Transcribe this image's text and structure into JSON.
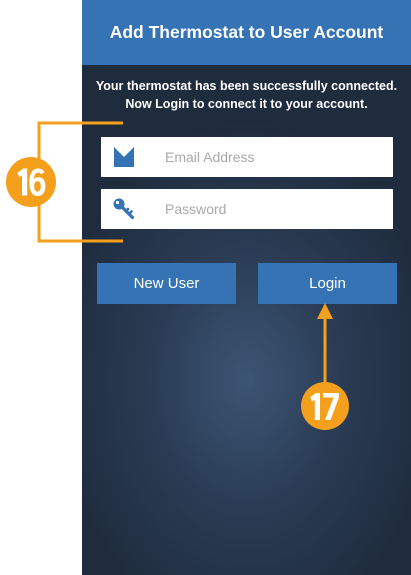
{
  "header": {
    "title": "Add Thermostat to User Account"
  },
  "message": {
    "line1": "Your thermostat has been successfully connected.",
    "line2": "Now Login to connect it to your account."
  },
  "form": {
    "email": {
      "placeholder": "Email Address",
      "value": "",
      "icon": "envelope-checkbox-icon"
    },
    "password": {
      "placeholder": "Password",
      "value": "",
      "icon": "key-icon"
    }
  },
  "buttons": {
    "new_user": "New User",
    "login": "Login"
  },
  "annotations": {
    "fields_callout": "16",
    "login_callout": "17",
    "color": "#f5a01c"
  },
  "colors": {
    "accent": "#3673b5",
    "background": "#2a3c54"
  }
}
